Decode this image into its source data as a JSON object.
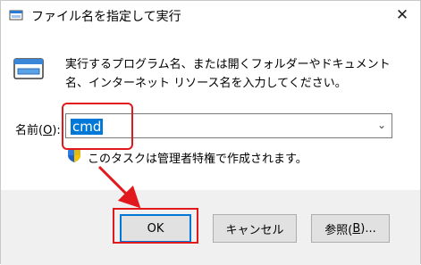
{
  "window": {
    "title": "ファイル名を指定して実行",
    "close_glyph": "✕"
  },
  "description": "実行するプログラム名、または開くフォルダーやドキュメント名、インターネット リソース名を入力してください。",
  "name_field": {
    "label_prefix": "名前(",
    "label_accel": "O",
    "label_suffix": "):",
    "value": "cmd"
  },
  "admin_note": "このタスクは管理者特権で作成されます。",
  "buttons": {
    "ok": "OK",
    "cancel": "キャンセル",
    "browse_prefix": "参照(",
    "browse_accel": "B",
    "browse_suffix": ")..."
  },
  "annotation_color": "#e2191c",
  "selection_color": "#0078d7"
}
